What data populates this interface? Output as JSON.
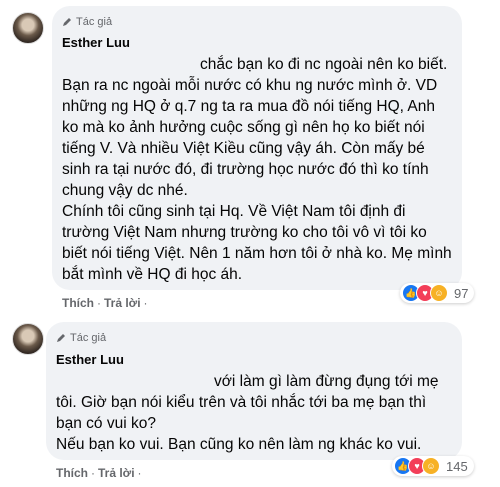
{
  "comments": [
    {
      "badge": "Tác giả",
      "author": "Esther Luu",
      "paragraphs": [
        "chắc bạn ko đi nc ngoài nên ko biết. Bạn ra nc ngoài mỗi nước có khu ng nước mình ở. VD những ng HQ ở q.7 ng ta ra mua đồ nói tiếng HQ, Anh ko mà ko ảnh hưởng cuộc sống gì nên họ ko biết nói tiếng V. Và nhiều Việt Kiều cũng vậy áh. Còn mấy bé sinh ra tại nước đó, đi trường học nước đó thì ko tính chung vậy dc nhé.",
        "Chính tôi cũng sinh tại Hq. Về Việt Nam tôi định đi trường Việt Nam nhưng trường ko cho tôi vô vì tôi ko biết nói tiếng Việt. Nên 1 năm hơn tôi ở nhà ko. Mẹ mình bắt mình về HQ đi học áh."
      ],
      "like_label": "Thích",
      "reply_label": "Trả lời",
      "reaction_count": "97"
    },
    {
      "badge": "Tác giả",
      "author": "Esther Luu",
      "paragraphs": [
        "với làm gì làm đừng đụng tới mẹ tôi. Giờ bạn nói kiểu trên và tôi nhắc tới ba mẹ bạn thì bạn có vui ko?",
        "Nếu bạn ko vui. Bạn cũng ko nên làm ng khác ko vui."
      ],
      "like_label": "Thích",
      "reply_label": "Trả lời",
      "reaction_count": "145"
    }
  ],
  "colors": {
    "bubble": "#f0f2f5",
    "like": "#1877f2",
    "love": "#f33e58",
    "haha": "#f7b125"
  },
  "icons": {
    "badge": "pencil-icon",
    "reactions": [
      "like-icon",
      "love-icon",
      "haha-icon"
    ]
  }
}
